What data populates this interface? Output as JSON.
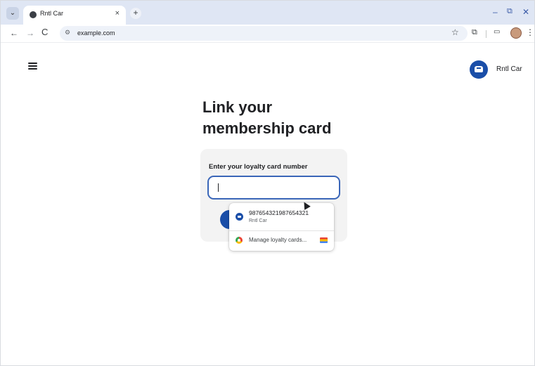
{
  "browser": {
    "tab_title": "Rntl Car",
    "tab_close": "×",
    "new_tab": "+",
    "url": "example.com",
    "window_controls": {
      "minimize": "–",
      "maximize": "⧉",
      "close": "✕"
    },
    "nav": {
      "back": "←",
      "forward": "→",
      "reload": "C"
    }
  },
  "header": {
    "brand_name": "Rntl Car",
    "brand_color": "#1a4ea8"
  },
  "main": {
    "title_line1": "Link your",
    "title_line2": "membership card",
    "field_label": "Enter your loyalty card number",
    "input_value": ""
  },
  "autofill": {
    "suggestion_number": "987654321987654321",
    "suggestion_sub": "Rntl Car",
    "manage_label": "Manage loyalty cards..."
  },
  "icons": [
    "search-tabs-icon",
    "site-favicon",
    "close-icon",
    "plus-icon",
    "back-arrow-icon",
    "forward-arrow-icon",
    "reload-icon",
    "site-info-icon",
    "star-icon",
    "extensions-icon",
    "media-icon",
    "avatar",
    "more-menu-icon",
    "hamburger-menu-icon",
    "car-logo-icon",
    "cursor-icon",
    "google-icon",
    "cards-icon"
  ]
}
